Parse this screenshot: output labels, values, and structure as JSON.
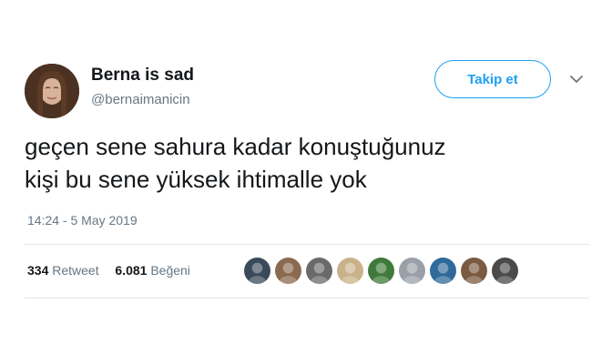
{
  "user": {
    "display_name": "Berna is sad",
    "handle": "@bernaimanicin"
  },
  "follow_button": {
    "label": "Takip et"
  },
  "tweet": {
    "lines": [
      "geçen sene sahura kadar konuştuğunuz",
      "kişi bu sene yüksek ihtimalle yok"
    ],
    "timestamp": "14:24 - 5 May 2019"
  },
  "stats": {
    "retweet_count": "334",
    "retweet_label": "Retweet",
    "like_count": "6.081",
    "like_label": "Beğeni"
  },
  "likers": [
    {
      "color": "#3a4a5a"
    },
    {
      "color": "#8a6a50"
    },
    {
      "color": "#6a6a6a"
    },
    {
      "color": "#c9b28a"
    },
    {
      "color": "#3f7a3a"
    },
    {
      "color": "#9aa0a8"
    },
    {
      "color": "#2f6a9a"
    },
    {
      "color": "#7a5a40"
    },
    {
      "color": "#4a4a4a"
    }
  ]
}
